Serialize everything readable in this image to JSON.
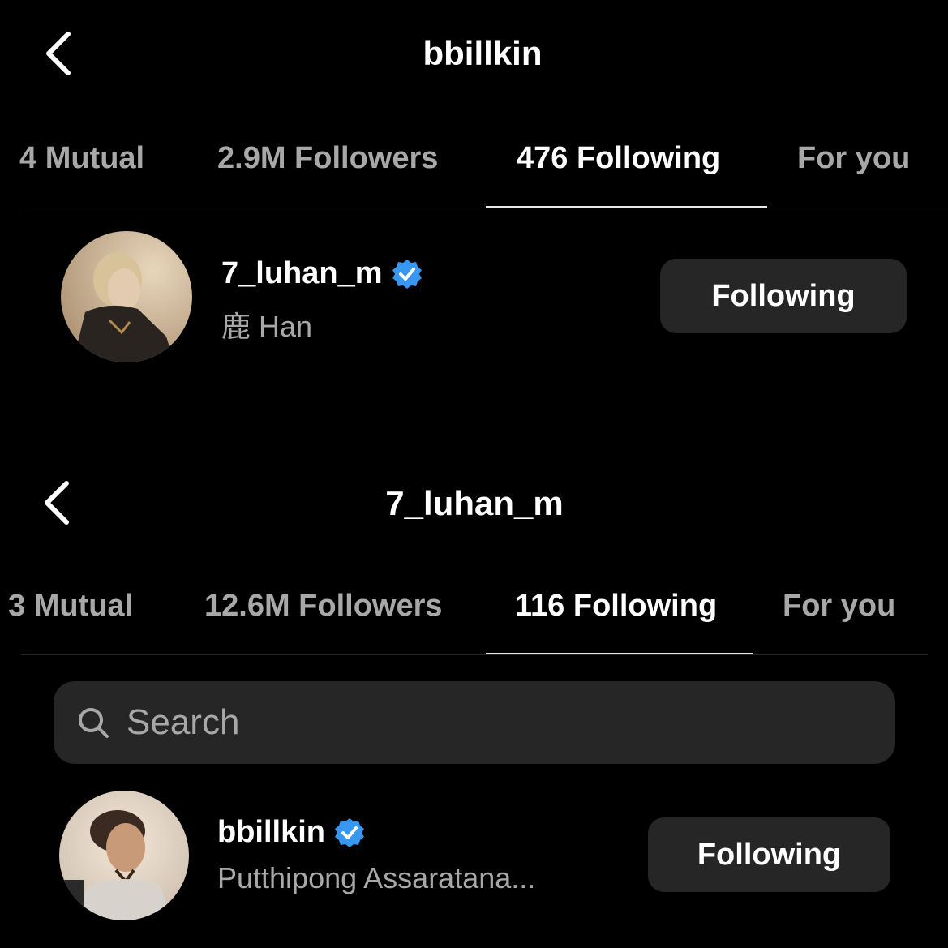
{
  "top": {
    "title": "bbillkin",
    "tabs": [
      {
        "label": "4 Mutual"
      },
      {
        "label": "2.9M Followers"
      },
      {
        "label": "476 Following"
      },
      {
        "label": "For you"
      }
    ],
    "active_tab": "476 Following",
    "row": {
      "username": "7_luhan_m",
      "fullname": "鹿 Han",
      "button": "Following",
      "verified": true
    }
  },
  "bottom": {
    "title": "7_luhan_m",
    "tabs": [
      {
        "label": "3 Mutual"
      },
      {
        "label": "12.6M Followers"
      },
      {
        "label": "116 Following"
      },
      {
        "label": "For you"
      }
    ],
    "active_tab": "116 Following",
    "search": {
      "placeholder": "Search"
    },
    "row": {
      "username": "bbillkin",
      "fullname": "Putthipong Assaratana...",
      "button": "Following",
      "verified": true
    }
  },
  "colors": {
    "background": "#000000",
    "text_primary": "#ffffff",
    "text_secondary": "#a8a8a8",
    "button_bg": "#262626",
    "verified_badge": "#3897f0"
  },
  "icons": {
    "back": "chevron-left-icon",
    "verified": "verified-badge-icon",
    "search": "search-icon"
  }
}
